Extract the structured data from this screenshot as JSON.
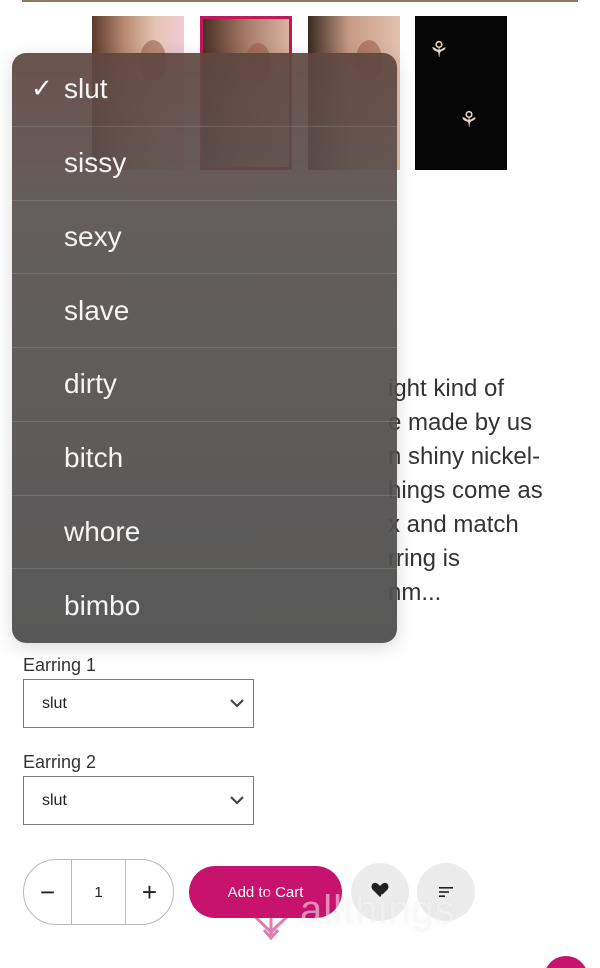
{
  "product": {
    "description_lines": [
      "ight kind of",
      "e made by us",
      "n shiny nickel-",
      "hings come as",
      "x and match",
      "rring is",
      "nm..."
    ]
  },
  "dropdown": {
    "selected": "slut",
    "check_icon": "✓",
    "options": [
      "slut",
      "sissy",
      "sexy",
      "slave",
      "dirty",
      "bitch",
      "whore",
      "bimbo"
    ]
  },
  "form": {
    "earring1": {
      "label": "Earring 1",
      "value": "slut"
    },
    "earring2": {
      "label": "Earring 2",
      "value": "slut"
    }
  },
  "quantity": {
    "minus": "−",
    "value": "1",
    "plus": "+"
  },
  "cart": {
    "add_label": "Add to Cart"
  },
  "watermark": {
    "text": "allthings"
  },
  "colors": {
    "accent": "#c8136e",
    "dropdown_bg": "#4e4e4e"
  }
}
